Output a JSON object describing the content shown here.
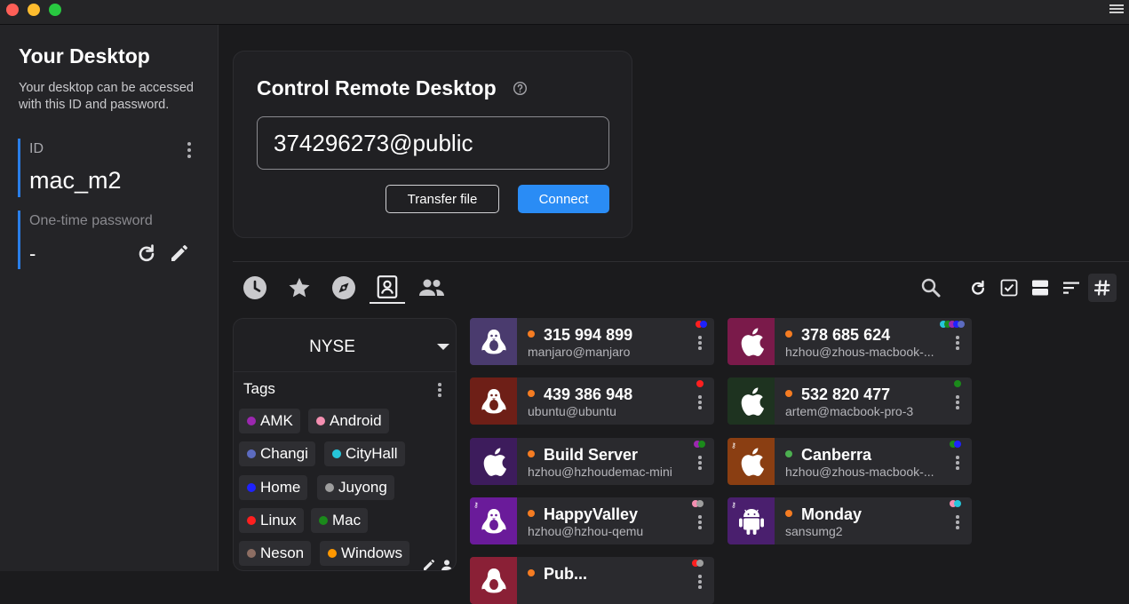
{
  "sidebar": {
    "title": "Your Desktop",
    "description": "Your desktop can be accessed with this ID and password.",
    "id_label": "ID",
    "id_value": "mac_m2",
    "password_label": "One-time password",
    "password_value": "-"
  },
  "connect": {
    "title": "Control Remote Desktop",
    "remote_id": "374296273@public",
    "transfer_label": "Transfer file",
    "connect_label": "Connect"
  },
  "tabs": [
    {
      "icon": "recent-sessions-icon"
    },
    {
      "icon": "favorites-star-icon"
    },
    {
      "icon": "discovered-compass-icon"
    },
    {
      "icon": "address-book-icon",
      "active": true
    },
    {
      "icon": "group-people-icon"
    }
  ],
  "toolbar": [
    "search-icon",
    "refresh-icon",
    "select-checkbox-icon",
    "view-toggle-icon",
    "sort-icon",
    "tag-hash-icon"
  ],
  "group": {
    "name": "NYSE",
    "tags_label": "Tags",
    "tags": [
      {
        "name": "AMK",
        "color": "#9c27b0"
      },
      {
        "name": "Android",
        "color": "#f48fb1"
      },
      {
        "name": "Changi",
        "color": "#5c6bc0"
      },
      {
        "name": "CityHall",
        "color": "#26c6da"
      },
      {
        "name": "Home",
        "color": "#1e22ff"
      },
      {
        "name": "Juyong",
        "color": "#9e9e9e"
      },
      {
        "name": "Linux",
        "color": "#ff1f1f"
      },
      {
        "name": "Mac",
        "color": "#1b8a1b"
      },
      {
        "name": "Neson",
        "color": "#8d6e63"
      },
      {
        "name": "Windows",
        "color": "#ff9800"
      }
    ]
  },
  "peers": [
    {
      "id": "315 994 899",
      "user": "manjaro@manjaro",
      "os": "linux",
      "os_color": "#4a3b6e",
      "status": "#f57c22",
      "tag_colors": [
        "#ff1f1f",
        "#1e22ff"
      ]
    },
    {
      "id": "378 685 624",
      "user": "hzhou@zhous-macbook-...",
      "os": "mac",
      "os_color": "#7a1a4a",
      "status": "#f57c22",
      "tag_colors": [
        "#26c6da",
        "#1b8a1b",
        "#9c27b0",
        "#1e22ff",
        "#5c6bc0"
      ]
    },
    {
      "id": "439 386 948",
      "user": "ubuntu@ubuntu",
      "os": "linux",
      "os_color": "#6e1f17",
      "status": "#f57c22",
      "tag_colors": [
        "#ff1f1f"
      ]
    },
    {
      "id": "532 820 477",
      "user": "artem@macbook-pro-3",
      "os": "mac",
      "os_color": "#1e3320",
      "status": "#f57c22",
      "tag_colors": [
        "#1b8a1b"
      ]
    },
    {
      "id": "Build Server",
      "user": "hzhou@hzhoudemac-mini",
      "os": "mac",
      "os_color": "#3d1c5c",
      "status": "#f57c22",
      "tag_colors": [
        "#9c27b0",
        "#1b8a1b"
      ]
    },
    {
      "id": "Canberra",
      "user": "hzhou@zhous-macbook-...",
      "os": "mac",
      "os_color": "#8a3e12",
      "status": "#4caf50",
      "tag_colors": [
        "#1b8a1b",
        "#1e22ff"
      ],
      "key": true
    },
    {
      "id": "HappyValley",
      "user": "hzhou@hzhou-qemu",
      "os": "linux",
      "os_color": "#6a1b9a",
      "status": "#f57c22",
      "tag_colors": [
        "#f48fb1",
        "#9e9e9e"
      ],
      "key": true
    },
    {
      "id": "Monday",
      "user": "sansumg2",
      "os": "android",
      "os_color": "#4a1f6e",
      "status": "#f57c22",
      "tag_colors": [
        "#f48fb1",
        "#26c6da"
      ],
      "key": true
    },
    {
      "id": "Pub...",
      "user": "",
      "os": "linux",
      "os_color": "#8a2036",
      "status": "#f57c22",
      "tag_colors": [
        "#ff1f1f",
        "#9e9e9e"
      ]
    }
  ]
}
